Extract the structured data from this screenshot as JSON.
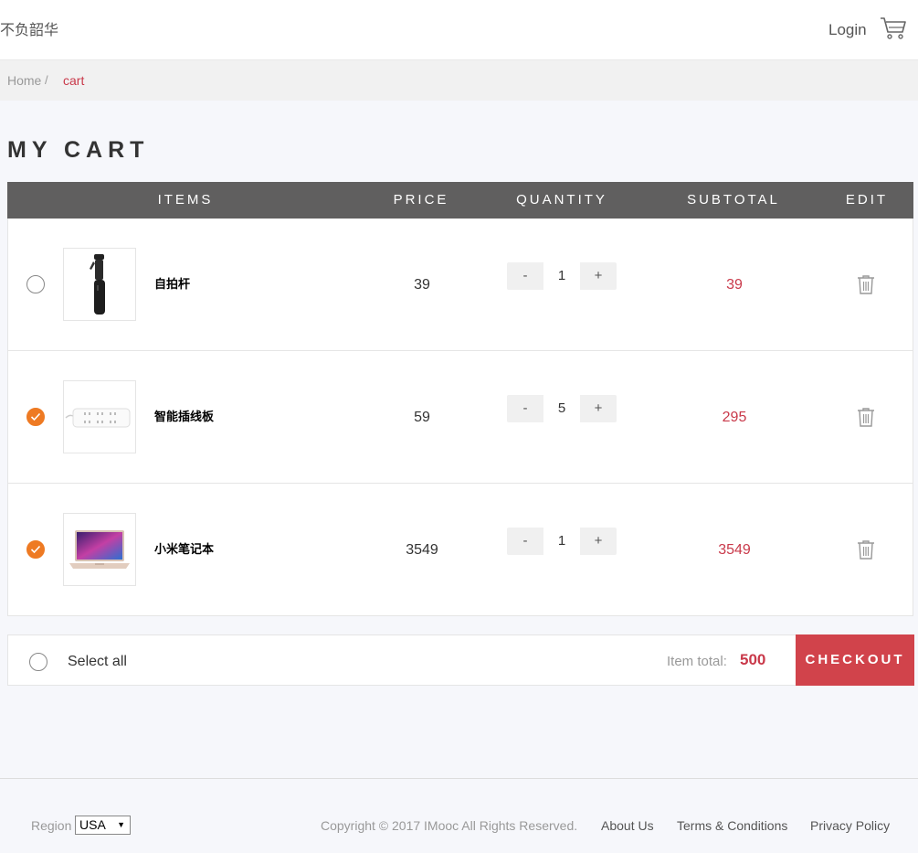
{
  "header": {
    "logo": "不负韶华",
    "login": "Login",
    "cart_icon": "cart-icon"
  },
  "breadcrumb": {
    "home": "Home",
    "separator": "/",
    "current": "cart"
  },
  "page_title": "MY CART",
  "table": {
    "headers": [
      "ITEMS",
      "PRICE",
      "QUANTITY",
      "SUBTOTAL",
      "EDIT"
    ],
    "rows": [
      {
        "checked": false,
        "name": "自拍杆",
        "price": "39",
        "quantity": "1",
        "subtotal": "39",
        "image_icon": "selfie-stick-image"
      },
      {
        "checked": true,
        "name": "智能插线板",
        "price": "59",
        "quantity": "5",
        "subtotal": "295",
        "image_icon": "power-strip-image"
      },
      {
        "checked": true,
        "name": "小米笔记本",
        "price": "3549",
        "quantity": "1",
        "subtotal": "3549",
        "image_icon": "laptop-image"
      }
    ],
    "minus_label": "-",
    "plus_label": "+"
  },
  "summary": {
    "select_all": "Select all",
    "total_label": "Item total:",
    "total_value": "500",
    "checkout": "CHECKOUT"
  },
  "footer": {
    "region_label": "Region",
    "region_value": "USA",
    "copyright": "Copyright © 2017 IMooc All Rights Reserved.",
    "links": [
      "About Us",
      "Terms & Conditions",
      "Privacy Policy"
    ]
  },
  "colors": {
    "accent_red": "#c9394a",
    "checkout_bg": "#d1434b",
    "check_orange": "#ee7a23",
    "table_header_bg": "#605f5f"
  }
}
